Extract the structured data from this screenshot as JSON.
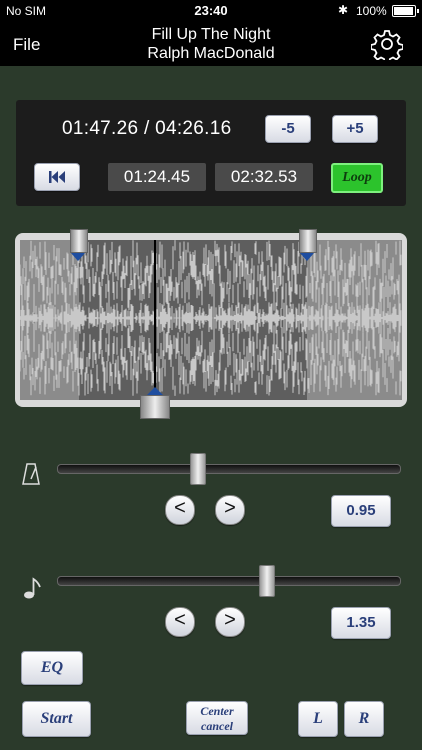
{
  "status_bar": {
    "carrier": "No SIM",
    "time": "23:40",
    "battery": "100%"
  },
  "nav": {
    "file_label": "File",
    "song_title": "Fill Up The Night",
    "artist": "Ralph MacDonald"
  },
  "transport": {
    "position": "01:47.26 / 04:26.16",
    "minus_label": "-5",
    "plus_label": "+5",
    "loop_start": "01:24.45",
    "loop_end": "02:32.53",
    "loop_label": "Loop"
  },
  "tempo": {
    "value": "0.95",
    "slider_fraction": 0.41
  },
  "pitch": {
    "value": "1.35",
    "slider_fraction": 0.61
  },
  "buttons": {
    "eq": "EQ",
    "start": "Start",
    "center_cancel": "Center cancel",
    "left": "L",
    "right": "R"
  },
  "icons": {
    "metronome": "metronome-icon",
    "note": "music-note-icon",
    "settings": "gear-icon",
    "rewind": "skip-back-icon"
  }
}
